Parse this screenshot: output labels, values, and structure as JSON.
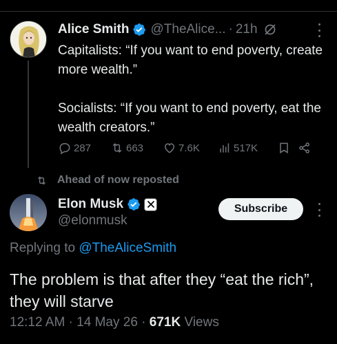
{
  "parent_tweet": {
    "author_name": "Alice Smith",
    "handle": "@TheAlice...",
    "separator": "·",
    "time": "21h",
    "text_paragraph_1": "Capitalists: “If you want to end poverty, create more wealth.”",
    "text_paragraph_2": "Socialists: “If you want to end poverty, eat the wealth creators.”",
    "replies": "287",
    "reposts": "663",
    "likes": "7.6K",
    "views": "517K"
  },
  "repost_label": "Ahead of now reposted",
  "main_tweet": {
    "author_name": "Elon Musk",
    "handle": "@elonmusk",
    "affiliate_badge_letter": "𝕏",
    "subscribe_label": "Subscribe",
    "replying_prefix": "Replying to ",
    "replying_handle": "@TheAliceSmith",
    "text": "The problem is that after they “eat the rich”, they will starve",
    "time": "12:12 AM",
    "sep1": " · ",
    "date": "14 May 26",
    "sep2": " · ",
    "views_count": "671K",
    "views_label": " Views"
  },
  "colors": {
    "background": "#000000",
    "text_primary": "#e7e9ea",
    "text_secondary": "#71767b",
    "accent": "#1d9bf0",
    "verified": "#1d9bf0"
  },
  "icons": [
    "reply-icon",
    "repost-icon",
    "like-icon",
    "views-icon",
    "bookmark-icon",
    "share-icon",
    "verified-icon",
    "grok-icon",
    "more-icon"
  ]
}
